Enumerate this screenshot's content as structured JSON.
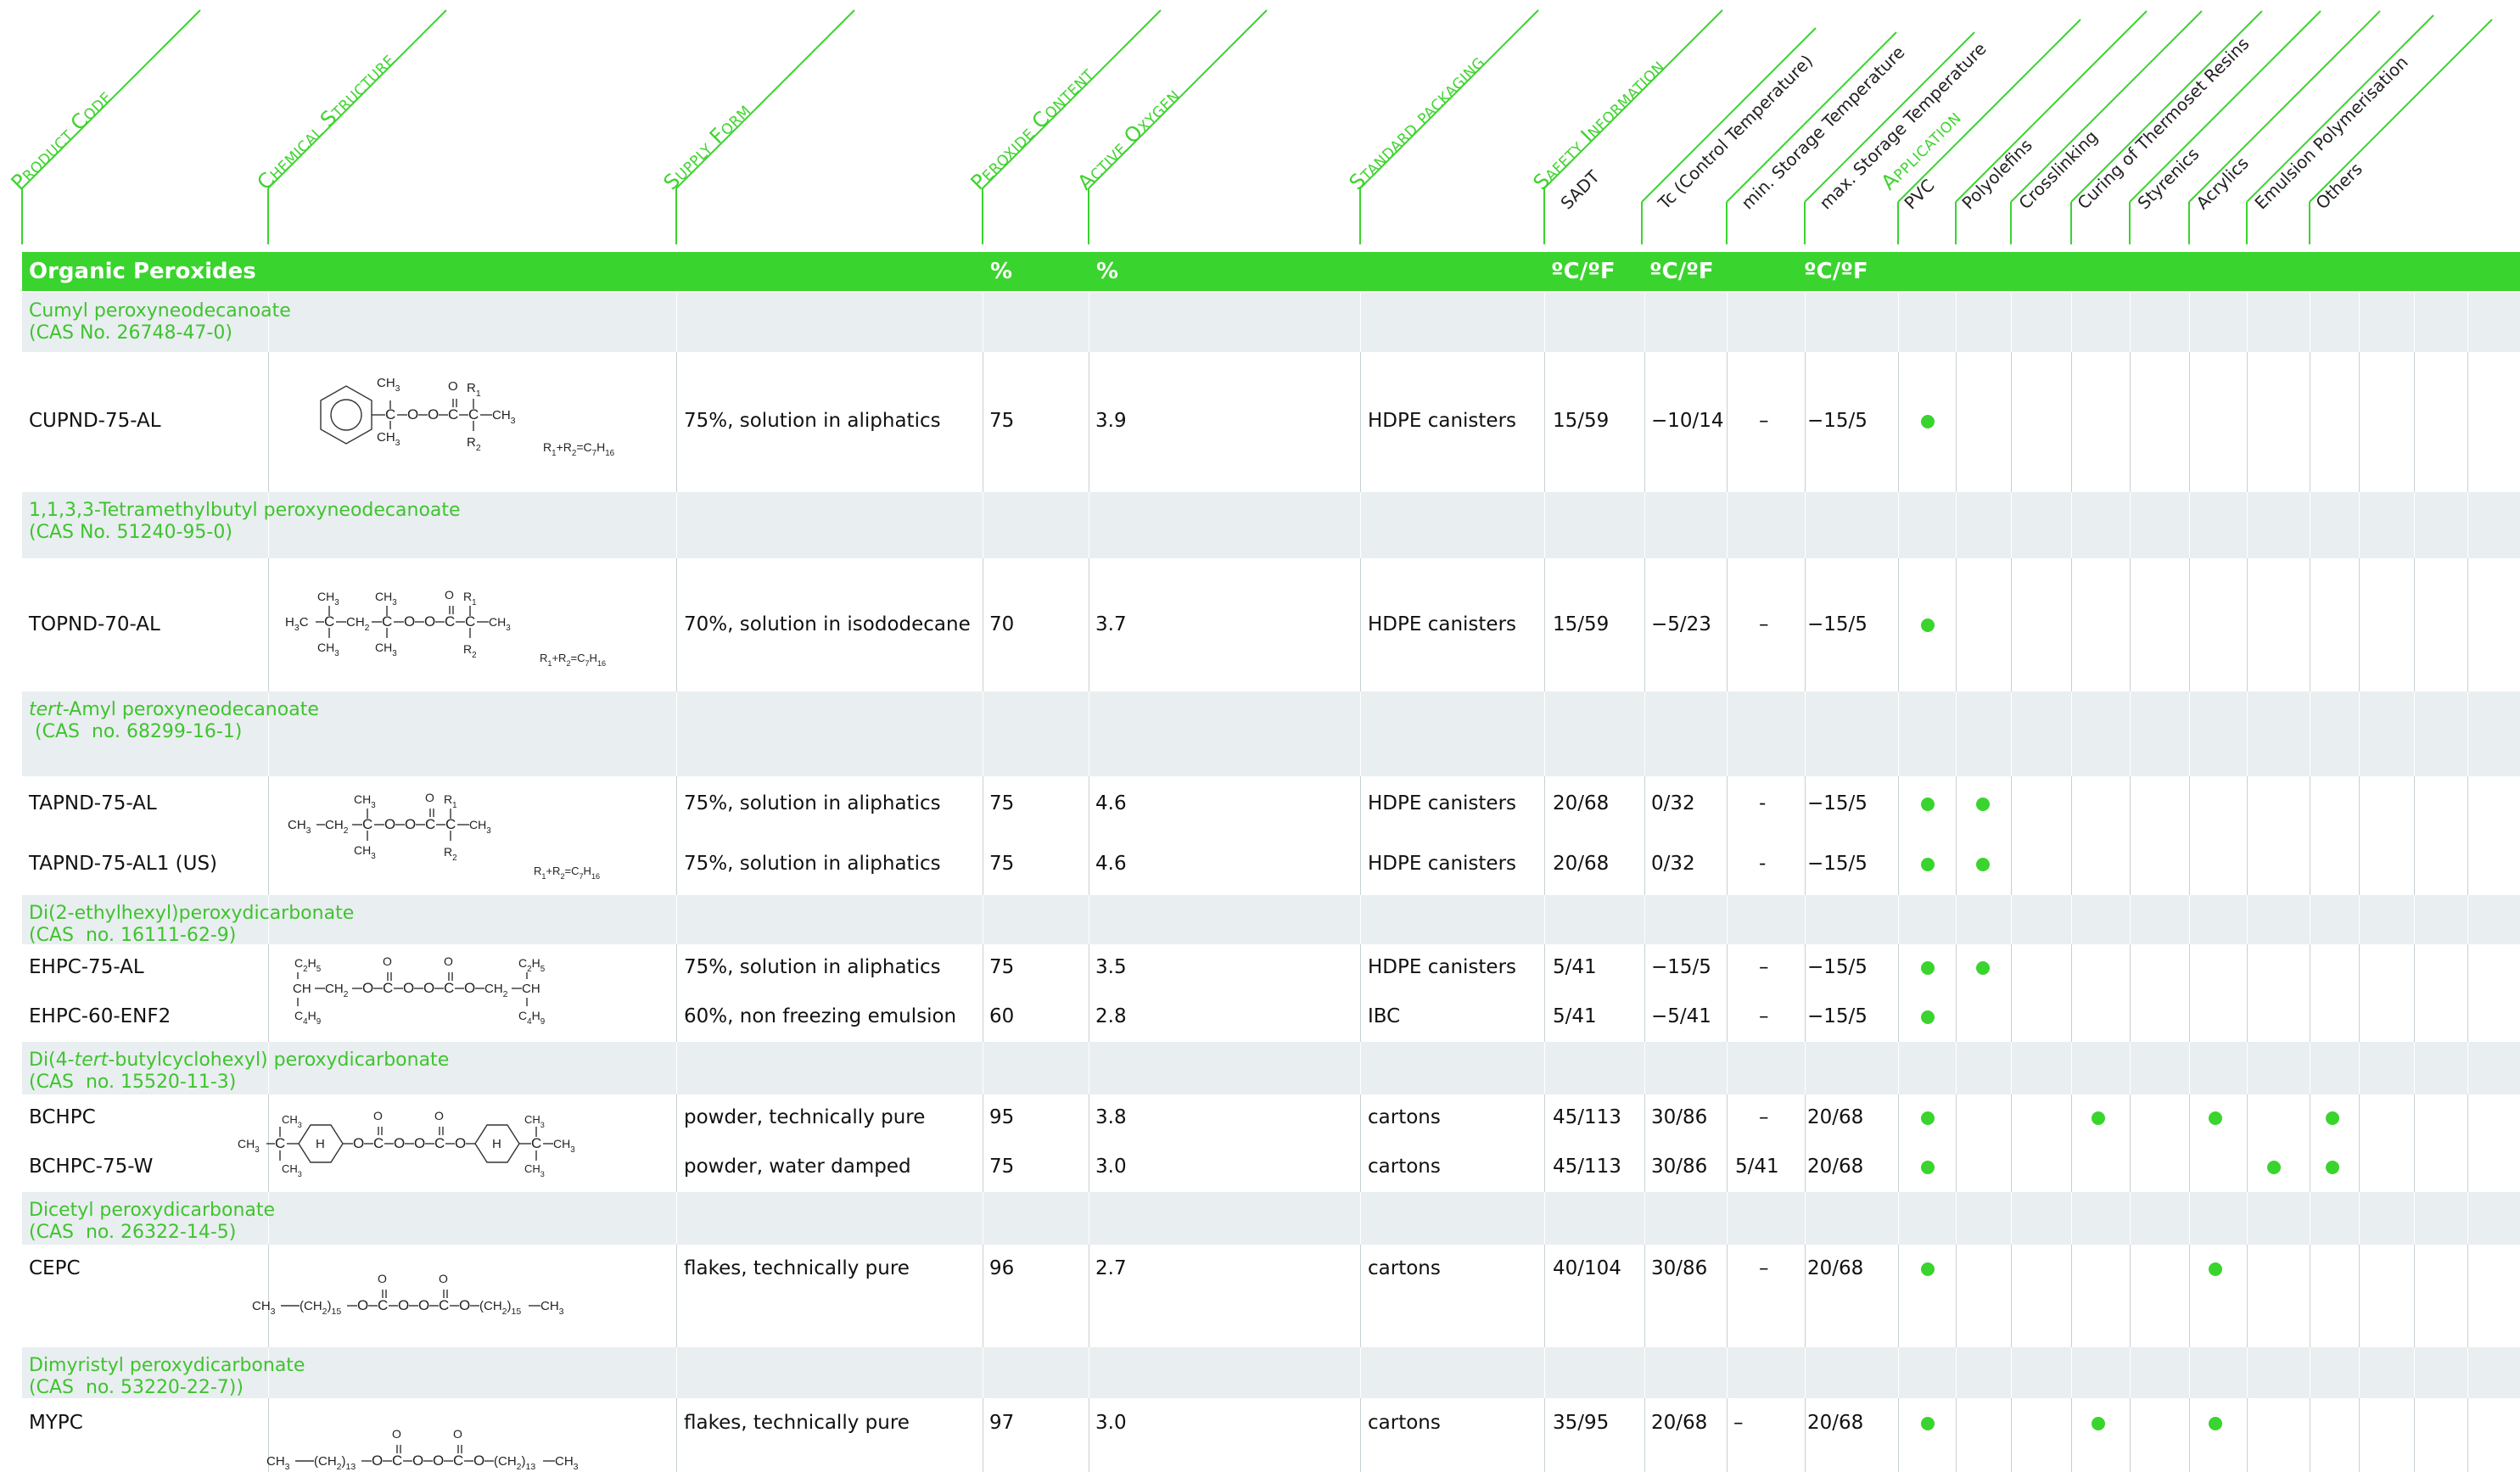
{
  "headers": {
    "product_code": "Product Code",
    "chemical_structure": "Chemical Structure",
    "supply_form": "Supply Form",
    "peroxide_content": "Peroxide Content",
    "active_oxygen": "Active Oxygen",
    "standard_packaging": "Standard packaging",
    "safety_information": "Safety Information",
    "sadt": "SADT",
    "tc": "Tc (Control Temperature)",
    "min_storage": "min. Storage Temperature",
    "max_storage": "max. Storage Temperature",
    "application": "Application",
    "pvc": "PVC",
    "polyolefins": "Polyolefins",
    "crosslinking": "Crosslinking",
    "curing": "Curing of Thermoset Resins",
    "styrenics": "Styrenics",
    "acrylics": "Acrylics",
    "emulsion": "Emulsion Polymerisation",
    "others": "Others"
  },
  "band": {
    "title": "Organic Peroxides",
    "unit_peroxide": "%",
    "unit_oxygen": "%",
    "unit_sadt": "ºC/ºF",
    "unit_tc": "ºC/ºF",
    "unit_max": "ºC/ºF"
  },
  "sections": [
    {
      "line1": "Cumyl peroxyneodecanoate",
      "line2": "(CAS No. 26748-47-0)"
    },
    {
      "line1": "1,1,3,3-Tetramethylbutyl peroxyneodecanoate",
      "line2": "(CAS No. 51240-95-0)"
    },
    {
      "line1_italic": "tert",
      "line1_rest": "-Amyl peroxyneodecanoate",
      "line2": " (CAS  no. 68299-16-1)"
    },
    {
      "line1": "Di(2-ethylhexyl)peroxydicarbonate",
      "line2": "(CAS  no. 16111-62-9)"
    },
    {
      "line1_pre": "Di(4-",
      "line1_italic": "tert",
      "line1_rest": "-butylcyclohexyl) peroxydicarbonate",
      "line2": "(CAS  no. 15520-11-3)"
    },
    {
      "line1": "Dicetyl peroxydicarbonate",
      "line2": "(CAS  no. 26322-14-5)"
    },
    {
      "line1": "Dimyristyl peroxydicarbonate",
      "line2": "(CAS  no. 53220-22-7))"
    }
  ],
  "rows": [
    {
      "code": "CUPND-75-AL",
      "supply": "75%, solution in aliphatics",
      "peroxide": "75",
      "oxygen": "3.9",
      "packaging": "HDPE canisters",
      "sadt": "15/59",
      "tc": "−10/14",
      "min": "–",
      "max": "−15/5",
      "apps": [
        "pvc"
      ]
    },
    {
      "code": "TOPND-70-AL",
      "supply": "70%, solution in isododecane",
      "peroxide": "70",
      "oxygen": "3.7",
      "packaging": "HDPE canisters",
      "sadt": "15/59",
      "tc": "−5/23",
      "min": "–",
      "max": "−15/5",
      "apps": [
        "pvc"
      ]
    },
    {
      "code": "TAPND-75-AL",
      "supply": "75%, solution in aliphatics",
      "peroxide": "75",
      "oxygen": "4.6",
      "packaging": "HDPE canisters",
      "sadt": "20/68",
      "tc": "0/32",
      "min": "-",
      "max": "−15/5",
      "apps": [
        "pvc",
        "polyolefins"
      ]
    },
    {
      "code": "TAPND-75-AL1 (US)",
      "supply": "75%, solution in aliphatics",
      "peroxide": "75",
      "oxygen": "4.6",
      "packaging": "HDPE canisters",
      "sadt": "20/68",
      "tc": "0/32",
      "min": "-",
      "max": "−15/5",
      "apps": [
        "pvc",
        "polyolefins"
      ]
    },
    {
      "code": "EHPC-75-AL",
      "supply": "75%, solution in aliphatics",
      "peroxide": "75",
      "oxygen": "3.5",
      "packaging": "HDPE canisters",
      "sadt": "5/41",
      "tc": "−15/5",
      "min": "–",
      "max": "−15/5",
      "apps": [
        "pvc",
        "polyolefins"
      ]
    },
    {
      "code": " EHPC-60-ENF2",
      "supply": "60%, non freezing emulsion",
      "peroxide": "60",
      "oxygen": "2.8",
      "packaging": "IBC",
      "sadt": "5/41",
      "tc": "−5/41",
      "min": "–",
      "max": "−15/5",
      "apps": [
        "pvc"
      ]
    },
    {
      "code": "BCHPC",
      "supply": "powder, technically pure",
      "peroxide": "95",
      "oxygen": "3.8",
      "packaging": "cartons",
      "sadt": "45/113",
      "tc": "30/86",
      "min": "–",
      "max": "20/68",
      "apps": [
        "pvc",
        "curing",
        "acrylics",
        "others"
      ]
    },
    {
      "code": "BCHPC-75-W",
      "supply": "powder, water damped",
      "peroxide": "75",
      "oxygen": "3.0",
      "packaging": "cartons",
      "sadt": "45/113",
      "tc": "30/86",
      "min": "5/41",
      "max": "20/68",
      "apps": [
        "pvc",
        "emulsion",
        "others"
      ]
    },
    {
      "code": "CEPC",
      "supply": "flakes, technically pure",
      "peroxide": "96",
      "oxygen": "2.7",
      "packaging": "cartons",
      "sadt": "40/104",
      "tc": "30/86",
      "min": "–",
      "max": "20/68",
      "apps": [
        "pvc",
        "acrylics"
      ]
    },
    {
      "code": "MYPC",
      "supply": "flakes, technically pure",
      "peroxide": "97",
      "oxygen": "3.0",
      "packaging": "cartons",
      "sadt": "35/95",
      "tc": "20/68",
      "min": "–",
      "max": "20/68",
      "apps": [
        "pvc",
        "curing",
        "acrylics"
      ]
    }
  ],
  "structures": {
    "ch3": "CH",
    "sub3": "3",
    "r": "R",
    "sub1": "1",
    "sub2": "2",
    "rsum_a": "R",
    "rsum_b": "+R",
    "rsum_c": "=C",
    "rsum_d": "H",
    "sub7": "7",
    "sub16": "16",
    "h3c": "H",
    "c": "C",
    "o": "O",
    "h": "H",
    "ch2": "CH",
    "sub5": "5",
    "sub4": "4",
    "sub9": "9",
    "c2h5": "C",
    "c4h9": "C",
    "ch": "CH",
    "ch2n": "(CH",
    "n15": ")",
    "sub15": "15",
    "sub13": "13"
  },
  "colors": {
    "accent": "#3ad42e",
    "section_bg": "#e9eef0",
    "title_green": "#3fc32f"
  }
}
